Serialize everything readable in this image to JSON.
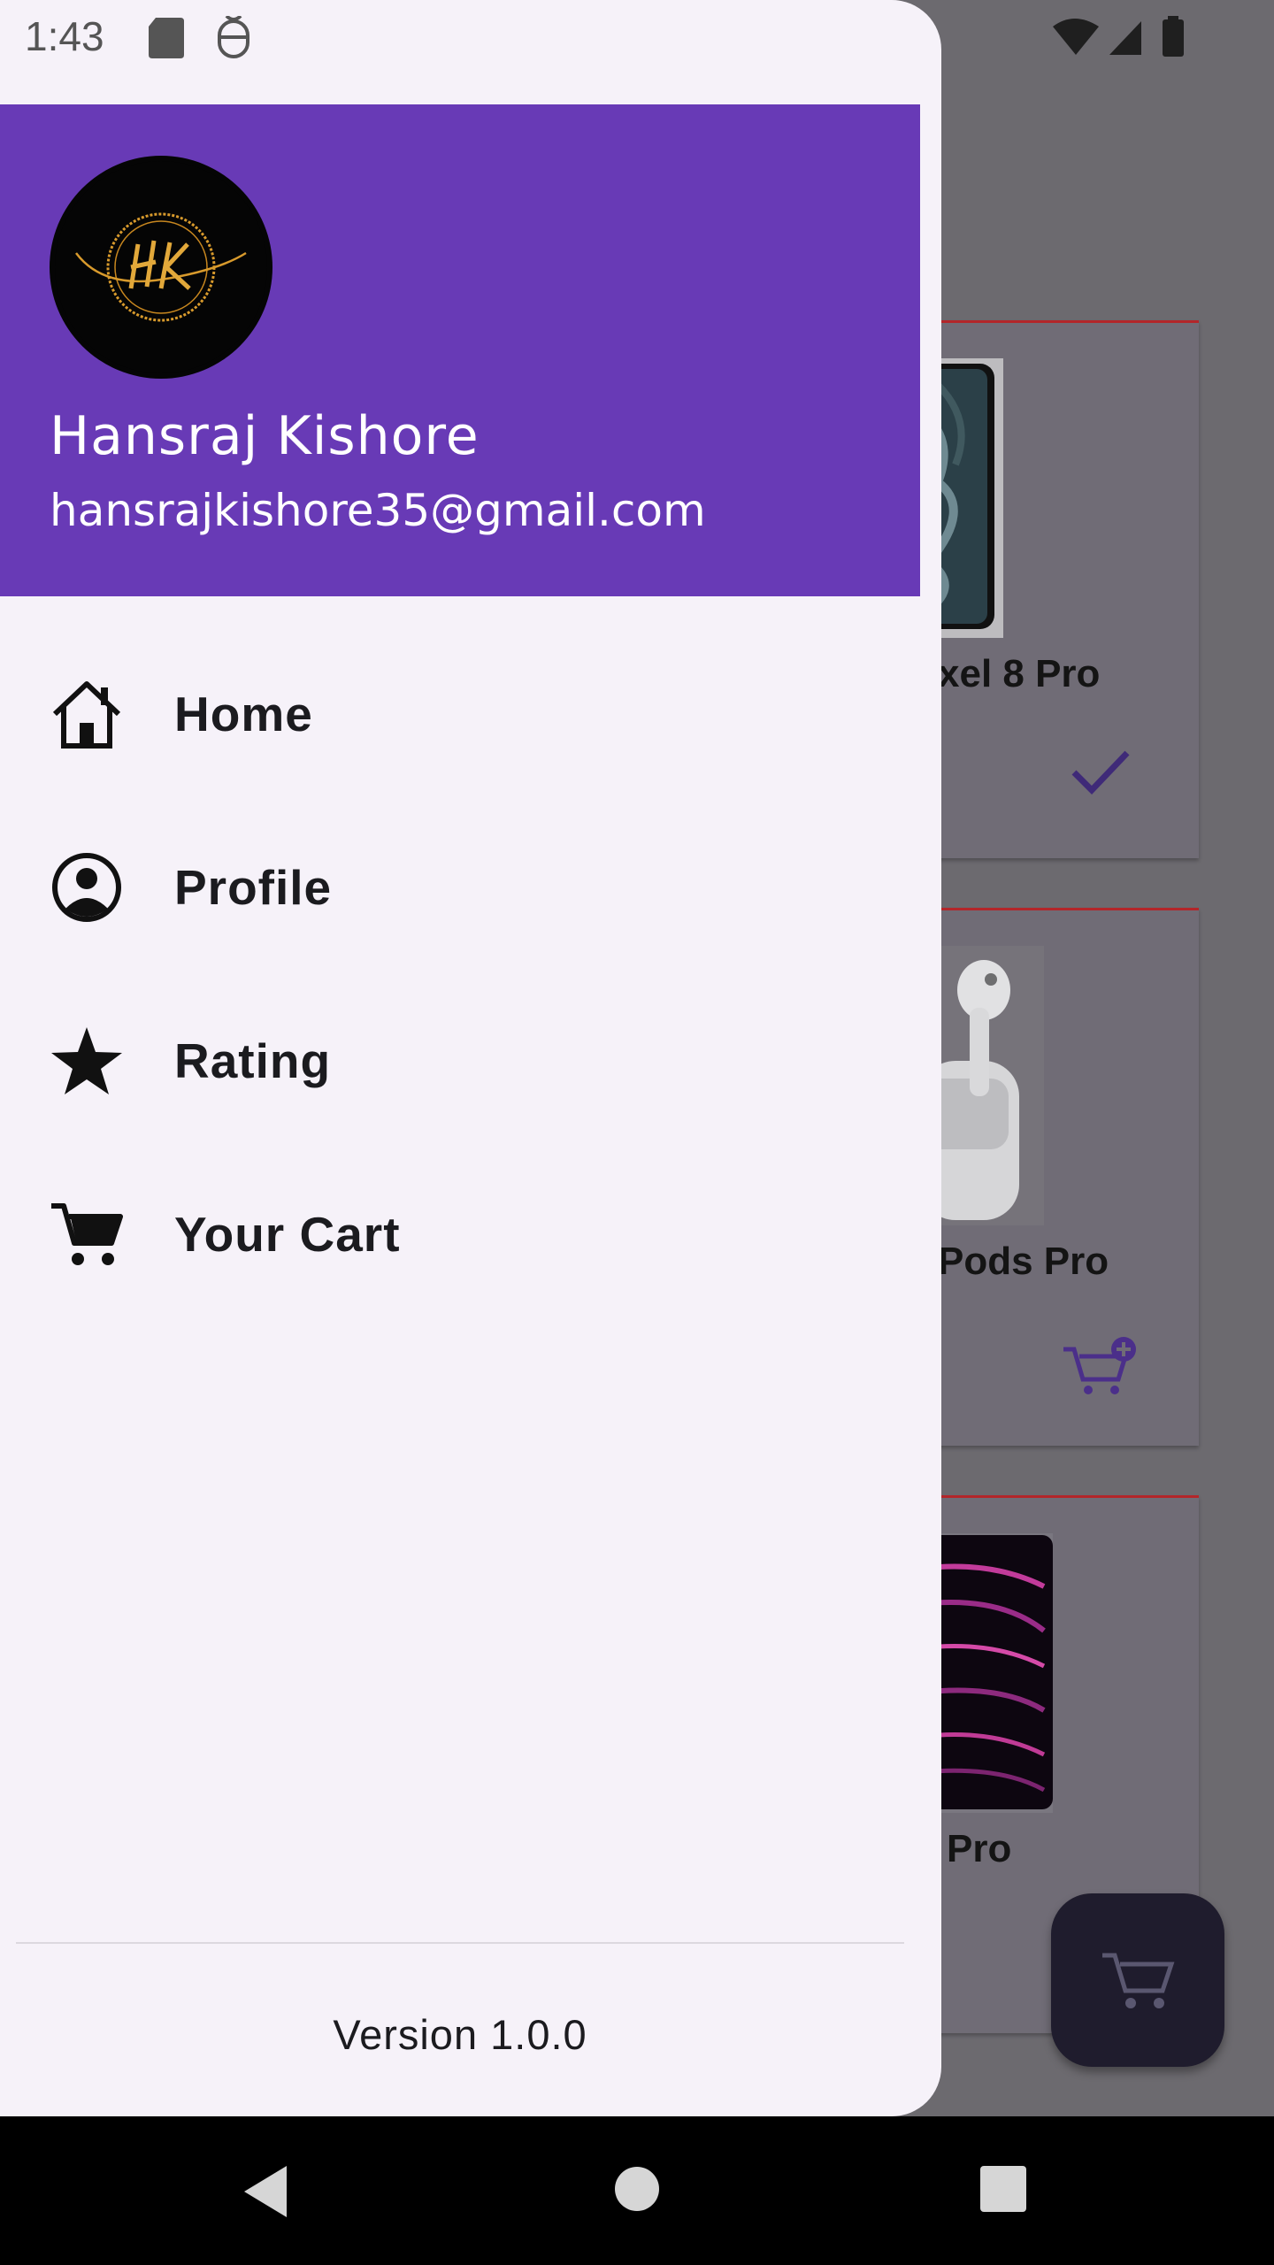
{
  "status_bar": {
    "time": "1:43",
    "left_icons": [
      "sd-card-icon",
      "mouse-icon"
    ],
    "right_icons": [
      "wifi-icon",
      "cell-signal-icon",
      "battery-icon"
    ]
  },
  "background_app": {
    "products": [
      {
        "title": "xel 8 Pro",
        "action_icon": "check-icon"
      },
      {
        "title": "Pods Pro",
        "action_icon": "add-to-cart-icon"
      },
      {
        "title": "Pro",
        "action_icon": ""
      }
    ],
    "fab_icon": "cart-icon"
  },
  "drawer": {
    "header": {
      "avatar_icon": "hk-logo",
      "user_name": "Hansraj Kishore",
      "user_email": "hansrajkishore35@gmail.com"
    },
    "items": [
      {
        "label": "Home",
        "icon": "home-icon"
      },
      {
        "label": "Profile",
        "icon": "account-circle-icon"
      },
      {
        "label": "Rating",
        "icon": "star-icon"
      },
      {
        "label": "Your Cart",
        "icon": "cart-icon"
      }
    ],
    "version": "Version 1.0.0"
  },
  "colors": {
    "drawer_header": "#683ab6",
    "drawer_bg": "#f6f2f9",
    "accent_icon": "#4b2f8a",
    "card_border": "#b3262a"
  }
}
